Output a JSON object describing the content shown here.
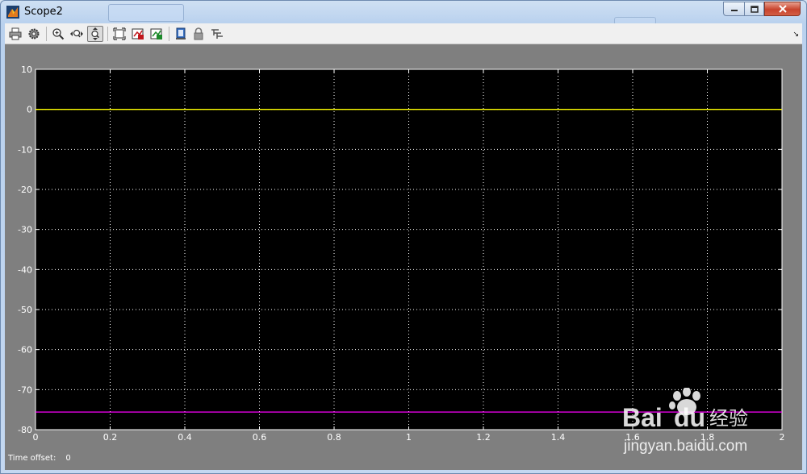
{
  "window": {
    "title": "Scope2",
    "background_tab_label": "",
    "controls": [
      "minimize",
      "maximize",
      "close"
    ]
  },
  "toolbar": {
    "buttons": [
      {
        "name": "print",
        "icon": "printer-icon"
      },
      {
        "name": "parameters",
        "icon": "gear-icon"
      },
      {
        "name": "zoom",
        "icon": "zoom-in-icon"
      },
      {
        "name": "zoom-x",
        "icon": "zoom-x-icon"
      },
      {
        "name": "zoom-y",
        "icon": "zoom-y-icon",
        "active": true
      },
      {
        "name": "autoscale",
        "icon": "autoscale-icon"
      },
      {
        "name": "save-axes",
        "icon": "save-axes-icon"
      },
      {
        "name": "restore-axes",
        "icon": "restore-axes-icon"
      },
      {
        "name": "floating-scope",
        "icon": "floating-scope-icon"
      },
      {
        "name": "lock-axes",
        "icon": "lock-icon"
      },
      {
        "name": "signal-selector",
        "icon": "signal-selector-icon"
      }
    ],
    "dock_glyph": "↘"
  },
  "footer": {
    "time_offset_label": "Time offset:",
    "time_offset_value": "0"
  },
  "colors": {
    "plot_bg": "#000000",
    "figure_bg": "#7f7f7f",
    "grid": "#ffffff",
    "series_1": "#ffff00",
    "series_2": "#ff00ff"
  },
  "chart_data": {
    "type": "line",
    "title": "",
    "xlabel": "",
    "ylabel": "",
    "xlim": [
      0,
      2
    ],
    "ylim": [
      -80,
      10
    ],
    "x_ticks": [
      "0",
      "0.2",
      "0.4",
      "0.6",
      "0.8",
      "1",
      "1.2",
      "1.4",
      "1.6",
      "1.8",
      "2"
    ],
    "y_ticks": [
      "10",
      "0",
      "-10",
      "-20",
      "-30",
      "-40",
      "-50",
      "-60",
      "-70",
      "-80"
    ],
    "grid": true,
    "series": [
      {
        "color": "#ffff00",
        "x": [
          0,
          2
        ],
        "y": [
          0,
          0
        ]
      },
      {
        "color": "#ff00ff",
        "x": [
          0,
          2
        ],
        "y": [
          -75.6,
          -75.6
        ]
      }
    ]
  },
  "watermark": {
    "brand": "Bai",
    "brand2": "du",
    "product": "经验",
    "url": "jingyan.baidu.com"
  }
}
